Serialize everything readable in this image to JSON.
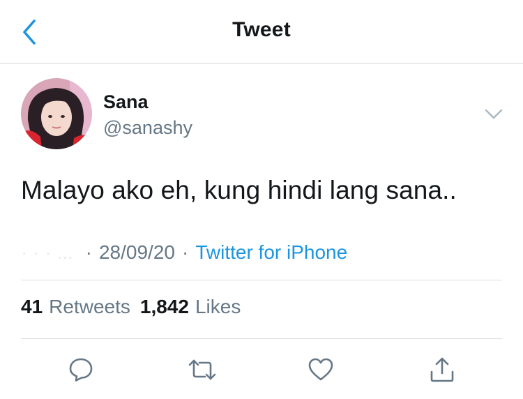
{
  "header": {
    "title": "Tweet",
    "back_icon": "chevron-left-icon",
    "accent_color": "#1b95e0"
  },
  "tweet": {
    "author": {
      "display_name": "Sana",
      "handle": "@sanashy"
    },
    "text": "Malayo ako eh, kung hindi lang sana..",
    "time": "· · ·  ...",
    "date": "28/09/20",
    "separator": "·",
    "source": "Twitter for iPhone"
  },
  "stats": {
    "retweets_count": "41",
    "retweets_label": "Retweets",
    "likes_count": "1,842",
    "likes_label": "Likes"
  },
  "actions": [
    {
      "name": "reply",
      "icon": "comment-icon"
    },
    {
      "name": "retweet",
      "icon": "retweet-icon"
    },
    {
      "name": "like",
      "icon": "heart-icon"
    },
    {
      "name": "share",
      "icon": "share-icon"
    }
  ],
  "colors": {
    "text_primary": "#14171a",
    "text_secondary": "#657786",
    "link": "#1b95e0",
    "divider": "#d8dde1"
  }
}
